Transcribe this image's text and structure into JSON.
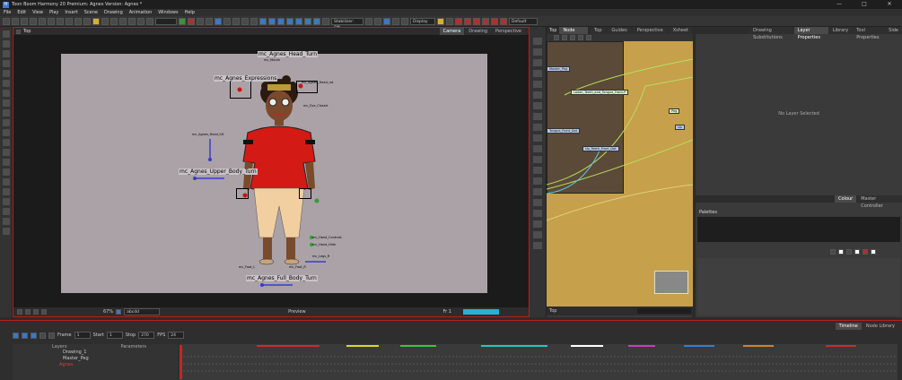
{
  "app": {
    "title": "Toon Boom Harmony 20 Premium: Agnes Version: Agnes *",
    "window_controls": [
      "—",
      "□",
      "✕"
    ]
  },
  "menu": [
    "File",
    "Edit",
    "View",
    "Play",
    "Insert",
    "Scene",
    "Drawing",
    "Animation",
    "Windows",
    "Help"
  ],
  "toolbar": {
    "stabilizer": "Stabilizer: Off",
    "display": "Display",
    "workspace": "Default"
  },
  "camera_panel": {
    "header_title": "Top",
    "tabs": [
      "Camera",
      "Drawing",
      "Perspective"
    ],
    "zoom": "67%",
    "preview_label": "Preview",
    "layer_name": "abcdd",
    "footer_frame": "Fr 1"
  },
  "canvas_labels": {
    "head_turn": "mc_Agnes_Head_Turn",
    "expressions": "mc_Agnes_Expressions",
    "upper_body_turn": "mc_Agnes_Upper_Body_Turn",
    "full_body_turn": "mc_Agnes_Full_Body_Turn",
    "small_head_rot": "mc_Agnes_Head_rot",
    "small_eye_closed": "mc_Eye_Closed",
    "small_mouth": "mc_Mouth",
    "small_hand_controls_1": "mc_Hand_Controls",
    "small_hand_controls_2": "mc_Hand_Hide",
    "small_legs": "mc_Legs_R",
    "small_foot_l": "mc_Foot_L",
    "small_foot_r": "mc_Foot_R",
    "small_head_tilt": "mc_Agnes_Head_tilt"
  },
  "node_view": {
    "header_title": "Top",
    "tabs": [
      "Node View",
      "Top",
      "Guides",
      "Perspective",
      "Xsheet"
    ],
    "nodes": [
      "Master_Peg",
      "Lower_Teeth_and_Tongue_Front-P",
      "Tongue_Front_Dot",
      "Up_Teeth_Front_Dot",
      "Peg",
      "Up"
    ],
    "footer_label": "Top"
  },
  "layer_properties": {
    "tabs": [
      "Drawing Substitutions",
      "Layer Properties",
      "Library",
      "Tool Properties",
      "Side"
    ],
    "empty_message": "No Layer Selected"
  },
  "colour_panel": {
    "tabs": [
      "Colour",
      "Master Controller"
    ],
    "palette_label": "Palettes"
  },
  "timeline": {
    "tabs": [
      "Timeline",
      "Node Library"
    ],
    "frame_label": "Frame",
    "frame_value": "1",
    "start_label": "Start",
    "start_value": "1",
    "stop_label": "Stop",
    "stop_value": "270",
    "fps_label": "FPS",
    "fps_value": "24",
    "layers_header": "Layers",
    "params_header": "Parameters",
    "layers": [
      "Drawing_1",
      "Master_Peg",
      "Agnes"
    ],
    "scene_markers": [
      "#c03030",
      "#d8d830",
      "#40c040",
      "#30c0c0",
      "#ffffff",
      "#c040c0",
      "#3080d0",
      "#d08030",
      "#c03030"
    ]
  },
  "colors": {
    "accent_red": "#b42020",
    "canvas_bg": "#aaa2a6",
    "node_view_bg": "#c6a04a"
  }
}
